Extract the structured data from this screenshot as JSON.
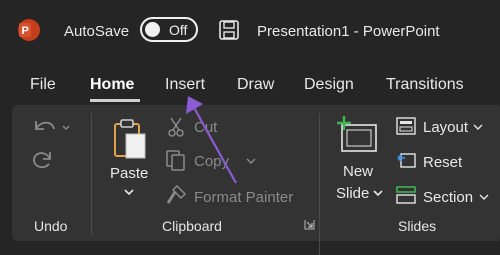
{
  "titlebar": {
    "autosave_label": "AutoSave",
    "autosave_state": "Off",
    "document_title": "Presentation1  -  PowerPoint"
  },
  "tabs": [
    {
      "label": "File"
    },
    {
      "label": "Home"
    },
    {
      "label": "Insert"
    },
    {
      "label": "Draw"
    },
    {
      "label": "Design"
    },
    {
      "label": "Transitions"
    }
  ],
  "ribbon": {
    "undo_group": {
      "label": "Undo"
    },
    "clipboard_group": {
      "label": "Clipboard",
      "paste_label": "Paste",
      "cut_label": "Cut",
      "copy_label": "Copy",
      "format_painter_label": "Format Painter"
    },
    "slides_group": {
      "label": "Slides",
      "new_slide_line1": "New",
      "new_slide_line2": "Slide",
      "layout_label": "Layout",
      "reset_label": "Reset",
      "section_label": "Section"
    }
  },
  "colors": {
    "brand": "#c43e1c",
    "annotation_arrow": "#8b5bd3",
    "disabled_text": "#8a8a8a"
  }
}
